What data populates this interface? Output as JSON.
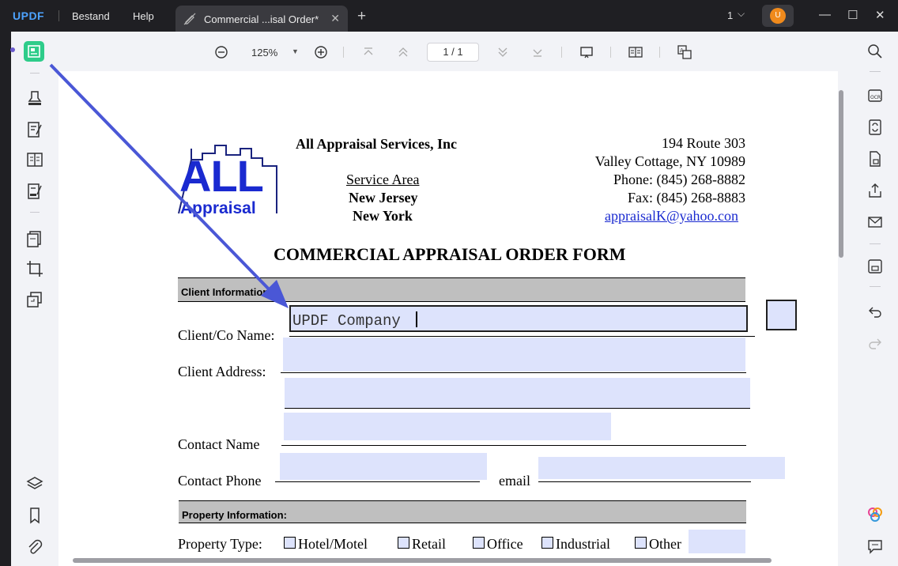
{
  "app": {
    "logo": "UPDF",
    "menu": [
      "Bestand",
      "Help"
    ],
    "tab_title": "Commercial ...isal Order*",
    "window_count": "1",
    "avatar_initial": "U"
  },
  "toolbar": {
    "zoom": "125%",
    "page_indicator": "1  /  1"
  },
  "document": {
    "company_name": "All Appraisal Services, Inc",
    "service_area_label": "Service Area",
    "areas": [
      "New Jersey",
      "New York"
    ],
    "address_line1": "194 Route 303",
    "address_line2": "Valley Cottage, NY 10989",
    "phone": "Phone:  (845) 268-8882",
    "fax": "Fax:  (845) 268-8883",
    "email_link": "appraisalK@yahoo.con",
    "logo_text_big": "ALL",
    "logo_text_small": "Appraisal",
    "form_title": "COMMERCIAL APPRAISAL ORDER FORM",
    "section_client": "Client Information:",
    "section_property": "Property Information:",
    "label_client_name": "Client/Co Name:",
    "client_name_value": "UPDF Company",
    "label_client_address": "Client Address:",
    "label_contact_name": "Contact Name",
    "label_contact_phone": "Contact Phone",
    "label_email": "email",
    "label_property_type": "Property Type:",
    "property_types": [
      "Hotel/Motel",
      "Retail",
      "Office",
      "Industrial",
      "Other"
    ]
  },
  "colors": {
    "field_fill": "#dde3fc",
    "accent_green": "#2ecc8a",
    "arrow": "#4a57d6",
    "avatar": "#f08a1c"
  }
}
